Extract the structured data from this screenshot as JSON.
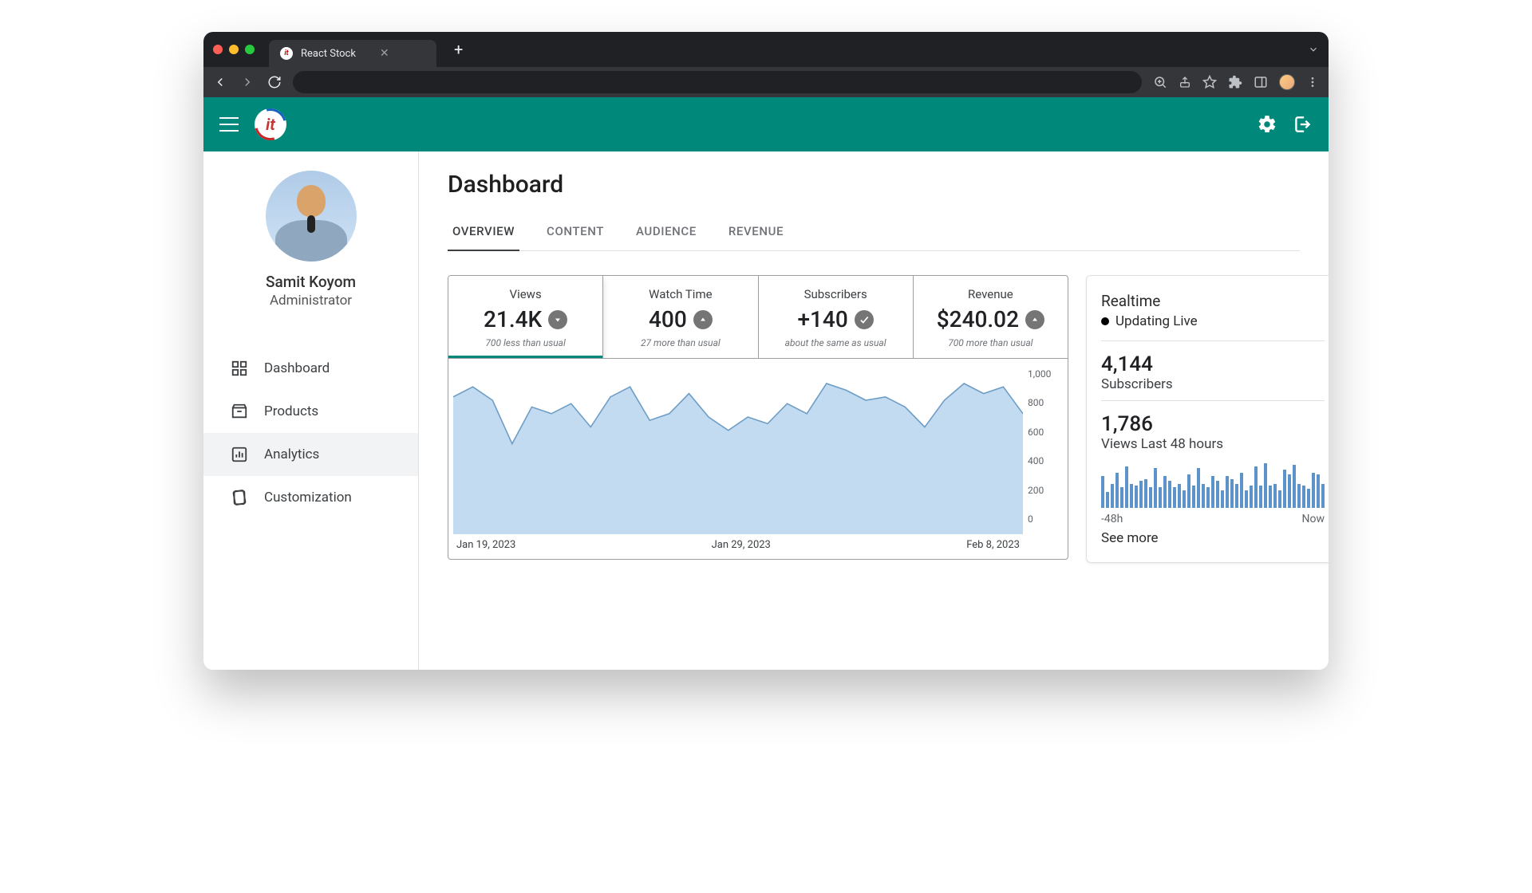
{
  "browser": {
    "tab_title": "React Stock"
  },
  "header": {},
  "profile": {
    "name": "Samit Koyom",
    "role": "Administrator"
  },
  "sidebar": {
    "items": [
      {
        "label": "Dashboard"
      },
      {
        "label": "Products"
      },
      {
        "label": "Analytics"
      },
      {
        "label": "Customization"
      }
    ],
    "active_index": 2
  },
  "page": {
    "title": "Dashboard",
    "tabs": [
      "OVERVIEW",
      "CONTENT",
      "AUDIENCE",
      "REVENUE"
    ],
    "active_tab": 0
  },
  "stats": [
    {
      "label": "Views",
      "value": "21.4K",
      "sub": "700 less than usual",
      "icon": "down"
    },
    {
      "label": "Watch Time",
      "value": "400",
      "sub": "27 more than usual",
      "icon": "up"
    },
    {
      "label": "Subscribers",
      "value": "+140",
      "sub": "about the same as usual",
      "icon": "check"
    },
    {
      "label": "Revenue",
      "value": "$240.02",
      "sub": "700 more than usual",
      "icon": "up"
    }
  ],
  "realtime": {
    "title": "Realtime",
    "live_label": "Updating Live",
    "subs_value": "4,144",
    "subs_label": "Subscribers",
    "views_value": "1,786",
    "views_label": "Views Last 48 hours",
    "range_start": "-48h",
    "range_end": "Now",
    "see_more": "See more"
  },
  "chart_data": {
    "type": "area",
    "title": "",
    "xlabel": "",
    "ylabel": "",
    "ylim": [
      0,
      1000
    ],
    "y_ticks": [
      1000,
      800,
      600,
      400,
      200,
      0
    ],
    "x_tick_labels": [
      "Jan 19, 2023",
      "Jan 29, 2023",
      "Feb 8, 2023"
    ],
    "series": [
      {
        "name": "Views",
        "values": [
          820,
          880,
          800,
          540,
          760,
          720,
          780,
          640,
          820,
          880,
          680,
          720,
          840,
          700,
          620,
          700,
          660,
          780,
          720,
          900,
          860,
          800,
          820,
          760,
          640,
          800,
          900,
          840,
          880,
          720
        ]
      }
    ]
  },
  "spark_data": {
    "type": "bar",
    "values": [
      40,
      20,
      30,
      44,
      26,
      52,
      30,
      28,
      34,
      36,
      26,
      50,
      26,
      40,
      34,
      26,
      30,
      22,
      42,
      28,
      50,
      30,
      26,
      40,
      34,
      22,
      40,
      36,
      30,
      44,
      22,
      28,
      52,
      28,
      56,
      28,
      30,
      22,
      48,
      42,
      54,
      30,
      28,
      24,
      44,
      42,
      30
    ]
  }
}
